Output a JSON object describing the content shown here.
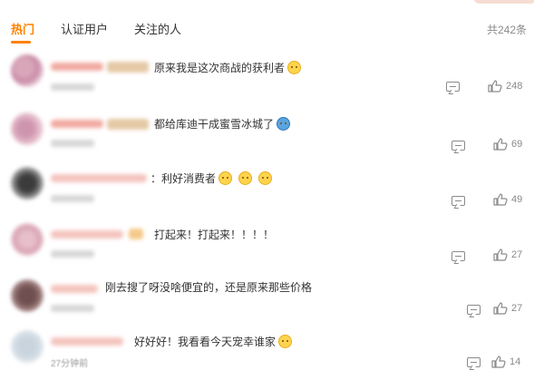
{
  "tabs": {
    "hot": "热门",
    "verified": "认证用户",
    "followed": "关注的人"
  },
  "total_count": "共242条",
  "colors": {
    "accent": "#ff8200",
    "meta": "#8a8a8a"
  },
  "comments": [
    {
      "text": "原来我是这次商战的获利者",
      "emoji": "dog-emoji",
      "likes": "248"
    },
    {
      "text": "都给库迪干成蜜雪冰城了",
      "emoji": "snowman-emoji",
      "likes": "69"
    },
    {
      "text": "：利好消费者",
      "emoji": "dog-emoji",
      "likes": "49"
    },
    {
      "text": "打起来！打起来！！！！",
      "emoji": "",
      "likes": "27"
    },
    {
      "text": "刚去搜了呀没啥便宜的，还是原来那些价格",
      "emoji": "",
      "likes": "27"
    },
    {
      "text": "好好好！我看看今天宠幸谁家",
      "emoji": "dog-emoji",
      "likes": "14",
      "time": "27分钟前"
    }
  ]
}
